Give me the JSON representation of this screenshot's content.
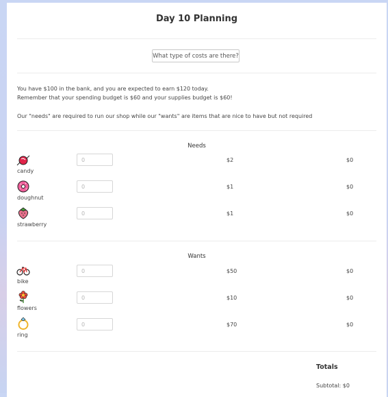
{
  "page": {
    "title": "Day 10 Planning"
  },
  "costs_button": {
    "label": "What type of costs are there?"
  },
  "intro": {
    "line1": "You have $100 in the bank, and you are expected to earn $120 today.",
    "line2": "Remember that your spending budget is $60 and your supplies budget is $60!",
    "line3": "Our \"needs\" are required to run our shop while our \"wants\" are items that are nice to have but not required"
  },
  "needs": {
    "heading": "Needs",
    "items": [
      {
        "name": "candy",
        "icon": "candy-icon",
        "placeholder": "0",
        "price": "$2",
        "total": "$0"
      },
      {
        "name": "doughnut",
        "icon": "doughnut-icon",
        "placeholder": "0",
        "price": "$1",
        "total": "$0"
      },
      {
        "name": "strawberry",
        "icon": "strawberry-icon",
        "placeholder": "0",
        "price": "$1",
        "total": "$0"
      }
    ]
  },
  "wants": {
    "heading": "Wants",
    "items": [
      {
        "name": "bike",
        "icon": "bike-icon",
        "placeholder": "0",
        "price": "$50",
        "total": "$0"
      },
      {
        "name": "flowers",
        "icon": "flower-icon",
        "placeholder": "0",
        "price": "$10",
        "total": "$0"
      },
      {
        "name": "ring",
        "icon": "ring-icon",
        "placeholder": "0",
        "price": "$70",
        "total": "$0"
      }
    ]
  },
  "totals": {
    "heading": "Totals",
    "subtotal_label": "Subtotal:",
    "subtotal_value": "$0"
  }
}
